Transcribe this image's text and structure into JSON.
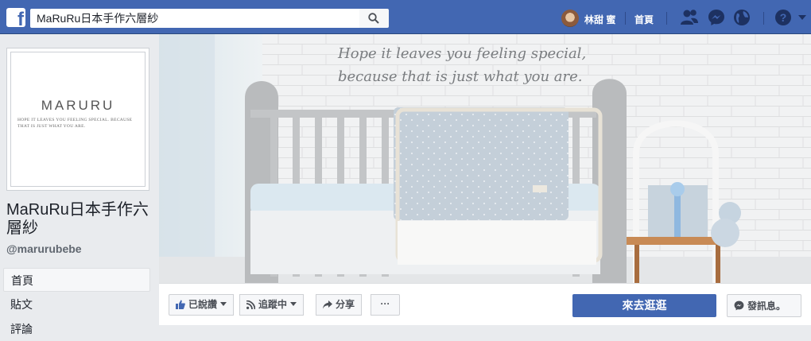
{
  "topbar": {
    "search_value": "MaRuRu日本手作六層紗",
    "profile_name": "林甜 蜜",
    "home_label": "首頁",
    "icons": [
      "facebook-logo",
      "search-icon",
      "friends-icon",
      "messenger-icon",
      "globe-icon",
      "help-icon"
    ]
  },
  "page": {
    "name": "MaRuRu日本手作六層紗",
    "handle": "@marurubebe",
    "logo_text": "MARURU",
    "logo_tagline": "HOPE IT LEAVES YOU FEELING SPECIAL. BECAUSE THAT IS JUST WHAT YOU ARE."
  },
  "nav": {
    "items": [
      {
        "label": "首頁",
        "active": true
      },
      {
        "label": "貼文",
        "active": false
      },
      {
        "label": "評論",
        "active": false
      }
    ]
  },
  "cover": {
    "quote_line1": "Hope it leaves you feeling special,",
    "quote_line2": "because that is just what you are."
  },
  "actions": {
    "liked_label": "已說讚",
    "following_label": "追蹤中",
    "share_label": "分享",
    "more_label": "···",
    "cta_label": "來去逛逛",
    "message_label": "發訊息。"
  },
  "colors": {
    "brand_blue": "#4267b2",
    "background": "#e9ebee"
  }
}
